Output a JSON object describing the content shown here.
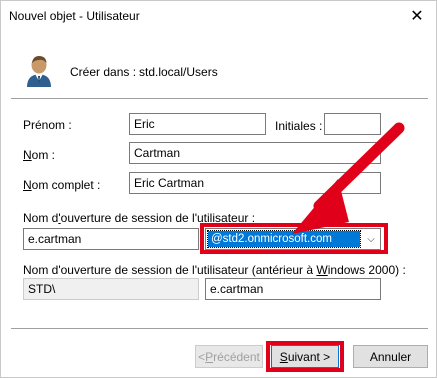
{
  "window": {
    "title": "Nouvel objet - Utilisateur",
    "close_glyph": "✕"
  },
  "header": {
    "created_in_label": "Créer dans :",
    "created_in_value": "std.local/Users",
    "icon": "user-icon"
  },
  "form": {
    "first_name": {
      "label": "Prénom :",
      "value": "Eric"
    },
    "initials": {
      "label": "Initiales :",
      "value": ""
    },
    "last_name": {
      "label_underlined": "N",
      "label_rest": "om :",
      "value": "Cartman"
    },
    "full_name": {
      "label_underlined": "N",
      "label_rest": "om complet :",
      "value": "Eric Cartman"
    },
    "logon_name": {
      "label_pre": "Nom d",
      "label_underlined": "'",
      "label_rest": "ouverture de session de l'utilisateur :",
      "value": "e.cartman",
      "domain": "@std2.onmicrosoft.com"
    },
    "logon_pre2000": {
      "label_pre": "Nom d'ouverture de session de l'utilisateur (antérieur à ",
      "label_underlined": "W",
      "label_rest": "indows 2000) :",
      "domain": "STD\\",
      "value": "e.cartman"
    }
  },
  "buttons": {
    "back": {
      "prefix": "< ",
      "underlined": "P",
      "rest": "récédent"
    },
    "next": {
      "underlined": "S",
      "rest": "uivant >"
    },
    "cancel": "Annuler"
  },
  "colors": {
    "highlight": "#e1001a",
    "selection": "#0078d7"
  }
}
